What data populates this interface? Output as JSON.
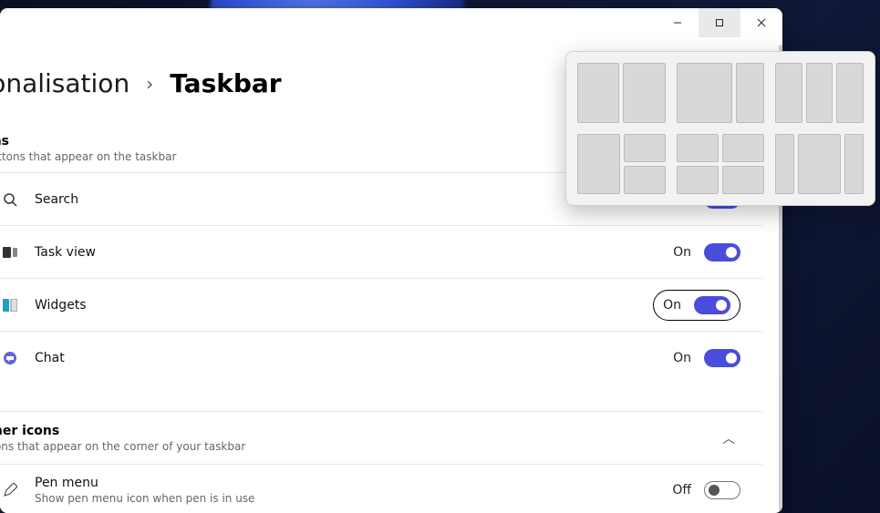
{
  "breadcrumb": {
    "parent": "Personalisation",
    "current": "Taskbar"
  },
  "titlebar": {
    "minimize": "Minimize",
    "maximize": "Maximize",
    "close": "Close"
  },
  "sections": {
    "items": {
      "title": "Taskbar items",
      "subtitle": "Show or hide buttons that appear on the taskbar"
    },
    "corner": {
      "title": "Taskbar corner icons",
      "subtitle": "Show or hide icons that appear on the corner of your taskbar"
    }
  },
  "rows": {
    "search": {
      "label": "Search",
      "state": "On"
    },
    "taskview": {
      "label": "Task view",
      "state": "On"
    },
    "widgets": {
      "label": "Widgets",
      "state": "On"
    },
    "chat": {
      "label": "Chat",
      "state": "On"
    },
    "penmenu": {
      "label": "Pen menu",
      "subtitle": "Show pen menu icon when pen is in use",
      "state": "Off"
    }
  },
  "snap_layouts": [
    "split-50-50",
    "split-70-30",
    "three-columns",
    "left-plus-stack",
    "quadrants",
    "center-wide"
  ],
  "colors": {
    "accent": "#4a4ddb",
    "window": "#ffffff",
    "flyout": "#f2f2f2"
  }
}
